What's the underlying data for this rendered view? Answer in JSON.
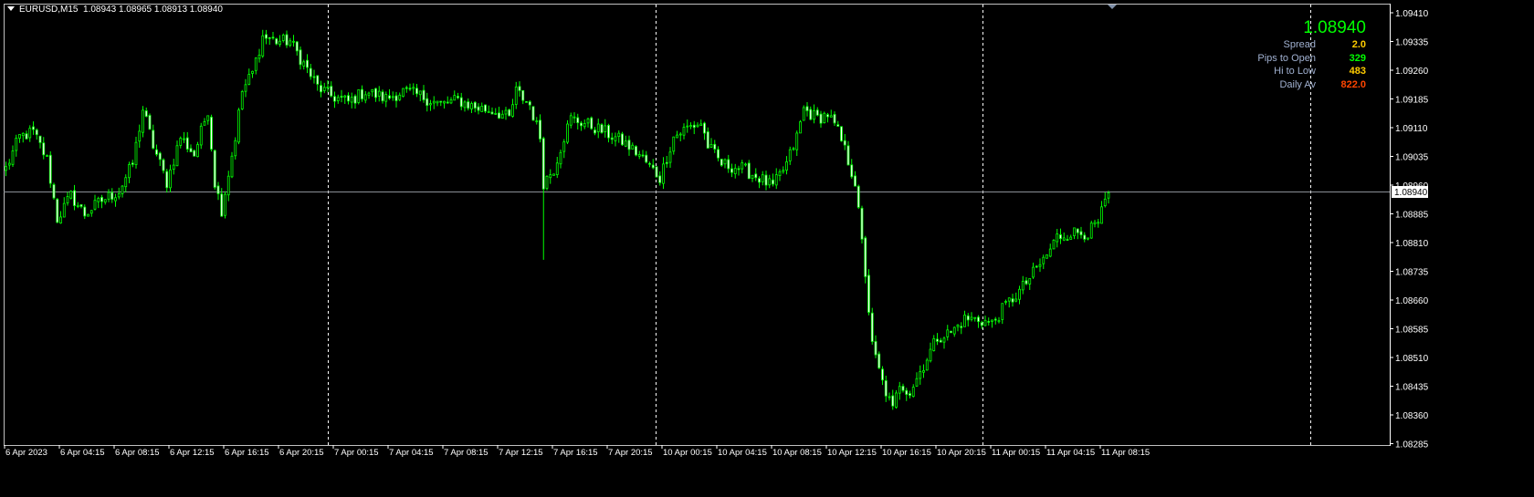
{
  "header": {
    "symbol": "EURUSD,M15",
    "ohlc": "1.08943 1.08965 1.08913 1.08940"
  },
  "info_panel": {
    "price": "1.08940",
    "rows": [
      {
        "label": "Spread",
        "value": "2.0",
        "color": "#ffcc00"
      },
      {
        "label": "Pips to Open",
        "value": "329",
        "color": "#00ff00"
      },
      {
        "label": "Hi to Low",
        "value": "483",
        "color": "#ffcc00"
      },
      {
        "label": "Daily Av",
        "value": "822.0",
        "color": "#ff4500"
      }
    ]
  },
  "colors": {
    "background": "#000000",
    "bull": "#00ff00",
    "bear_body": "#ffffff",
    "grid": "#ffffff",
    "axis": "#ffffff"
  },
  "chart_data": {
    "type": "candlestick",
    "symbol": "EURUSD",
    "timeframe": "M15",
    "current_price": 1.0894,
    "ylim": [
      1.08255,
      1.0944
    ],
    "y_ticks": [
      "1.09410",
      "1.09335",
      "1.09260",
      "1.09185",
      "1.09110",
      "1.09035",
      "1.08960",
      "1.08885",
      "1.08810",
      "1.08735",
      "1.08660",
      "1.08585",
      "1.08510",
      "1.08435",
      "1.08360",
      "1.08285"
    ],
    "x_ticks": [
      "6 Apr 2023",
      "6 Apr 04:15",
      "6 Apr 08:15",
      "6 Apr 12:15",
      "6 Apr 16:15",
      "6 Apr 20:15",
      "7 Apr 00:15",
      "7 Apr 04:15",
      "7 Apr 08:15",
      "7 Apr 12:15",
      "7 Apr 16:15",
      "7 Apr 20:15",
      "10 Apr 00:15",
      "10 Apr 04:15",
      "10 Apr 08:15",
      "10 Apr 12:15",
      "10 Apr 16:15",
      "10 Apr 20:15",
      "11 Apr 00:15",
      "11 Apr 04:15",
      "11 Apr 08:15"
    ],
    "bars_per_tick": 16,
    "total_bars": 323,
    "close_path": [
      [
        0,
        1.09003
      ],
      [
        4,
        1.09086
      ],
      [
        8,
        1.09098
      ],
      [
        12,
        1.09027
      ],
      [
        15,
        1.08872
      ],
      [
        19,
        1.08932
      ],
      [
        23,
        1.08884
      ],
      [
        28,
        1.0892
      ],
      [
        33,
        1.08944
      ],
      [
        37,
        1.09015
      ],
      [
        40,
        1.09158
      ],
      [
        43,
        1.09063
      ],
      [
        47,
        1.08967
      ],
      [
        51,
        1.09086
      ],
      [
        55,
        1.09039
      ],
      [
        59,
        1.09158
      ],
      [
        61,
        1.08967
      ],
      [
        63,
        1.08896
      ],
      [
        67,
        1.09086
      ],
      [
        69,
        1.09205
      ],
      [
        72,
        1.09253
      ],
      [
        75,
        1.09348
      ],
      [
        79,
        1.09336
      ],
      [
        83,
        1.09336
      ],
      [
        87,
        1.09277
      ],
      [
        91,
        1.09217
      ],
      [
        95,
        1.09193
      ],
      [
        100,
        1.09177
      ],
      [
        105,
        1.09205
      ],
      [
        111,
        1.09186
      ],
      [
        116,
        1.09205
      ],
      [
        121,
        1.09193
      ],
      [
        127,
        1.0917
      ],
      [
        132,
        1.09182
      ],
      [
        137,
        1.09163
      ],
      [
        143,
        1.09153
      ],
      [
        147,
        1.09134
      ],
      [
        149,
        1.09205
      ],
      [
        153,
        1.0917
      ],
      [
        156,
        1.09086
      ],
      [
        157,
        1.08967
      ],
      [
        160,
        1.09003
      ],
      [
        163,
        1.09086
      ],
      [
        165,
        1.09134
      ],
      [
        169,
        1.09122
      ],
      [
        175,
        1.09098
      ],
      [
        180,
        1.09074
      ],
      [
        185,
        1.09039
      ],
      [
        191,
        1.08979
      ],
      [
        195,
        1.09086
      ],
      [
        199,
        1.0911
      ],
      [
        203,
        1.09122
      ],
      [
        205,
        1.09063
      ],
      [
        209,
        1.09015
      ],
      [
        215,
        1.09003
      ],
      [
        220,
        1.08979
      ],
      [
        224,
        1.08955
      ],
      [
        228,
        1.09015
      ],
      [
        231,
        1.09086
      ],
      [
        233,
        1.09158
      ],
      [
        237,
        1.09134
      ],
      [
        240,
        1.09146
      ],
      [
        243,
        1.09098
      ],
      [
        245,
        1.09051
      ],
      [
        248,
        1.08967
      ],
      [
        251,
        1.08729
      ],
      [
        253,
        1.08539
      ],
      [
        256,
        1.08444
      ],
      [
        259,
        1.08372
      ],
      [
        261,
        1.08444
      ],
      [
        264,
        1.0842
      ],
      [
        268,
        1.08491
      ],
      [
        272,
        1.08563
      ],
      [
        276,
        1.08575
      ],
      [
        280,
        1.0861
      ],
      [
        284,
        1.0861
      ],
      [
        288,
        1.08598
      ],
      [
        292,
        1.08646
      ],
      [
        296,
        1.08682
      ],
      [
        300,
        1.08729
      ],
      [
        304,
        1.08777
      ],
      [
        307,
        1.08825
      ],
      [
        311,
        1.08836
      ],
      [
        316,
        1.08836
      ],
      [
        319,
        1.0886
      ],
      [
        322,
        1.0894
      ]
    ],
    "spikes": [
      [
        157,
        1.08765
      ]
    ]
  }
}
